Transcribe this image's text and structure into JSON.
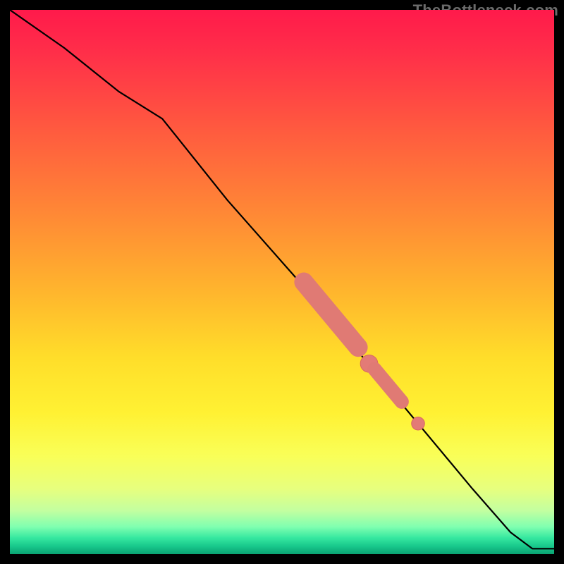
{
  "watermark": "TheBottleneck.com",
  "chart_data": {
    "type": "line",
    "title": "",
    "xlabel": "",
    "ylabel": "",
    "xlim": [
      0,
      100
    ],
    "ylim": [
      0,
      100
    ],
    "grid": false,
    "legend": false,
    "axes_visible": false,
    "background": "heatmap-vertical-gradient",
    "series": [
      {
        "name": "bottleneck-curve",
        "x": [
          0,
          10,
          20,
          28,
          40,
          55,
          70,
          85,
          92,
          96,
          100
        ],
        "y": [
          100,
          93,
          85,
          80,
          65,
          48,
          30,
          12,
          4,
          1,
          1
        ]
      }
    ],
    "annotations": [
      {
        "name": "highlight-segment-1",
        "type": "capsule",
        "x_range": [
          54,
          64
        ],
        "y_range": [
          38,
          50
        ],
        "thickness": 3.5
      },
      {
        "name": "highlight-dot-1",
        "type": "dot",
        "x": 66,
        "y": 35,
        "r": 1.6
      },
      {
        "name": "highlight-segment-2",
        "type": "capsule",
        "x_range": [
          67,
          72
        ],
        "y_range": [
          28,
          34
        ],
        "thickness": 2.6
      },
      {
        "name": "highlight-dot-2",
        "type": "dot",
        "x": 75,
        "y": 24,
        "r": 1.2
      }
    ]
  }
}
